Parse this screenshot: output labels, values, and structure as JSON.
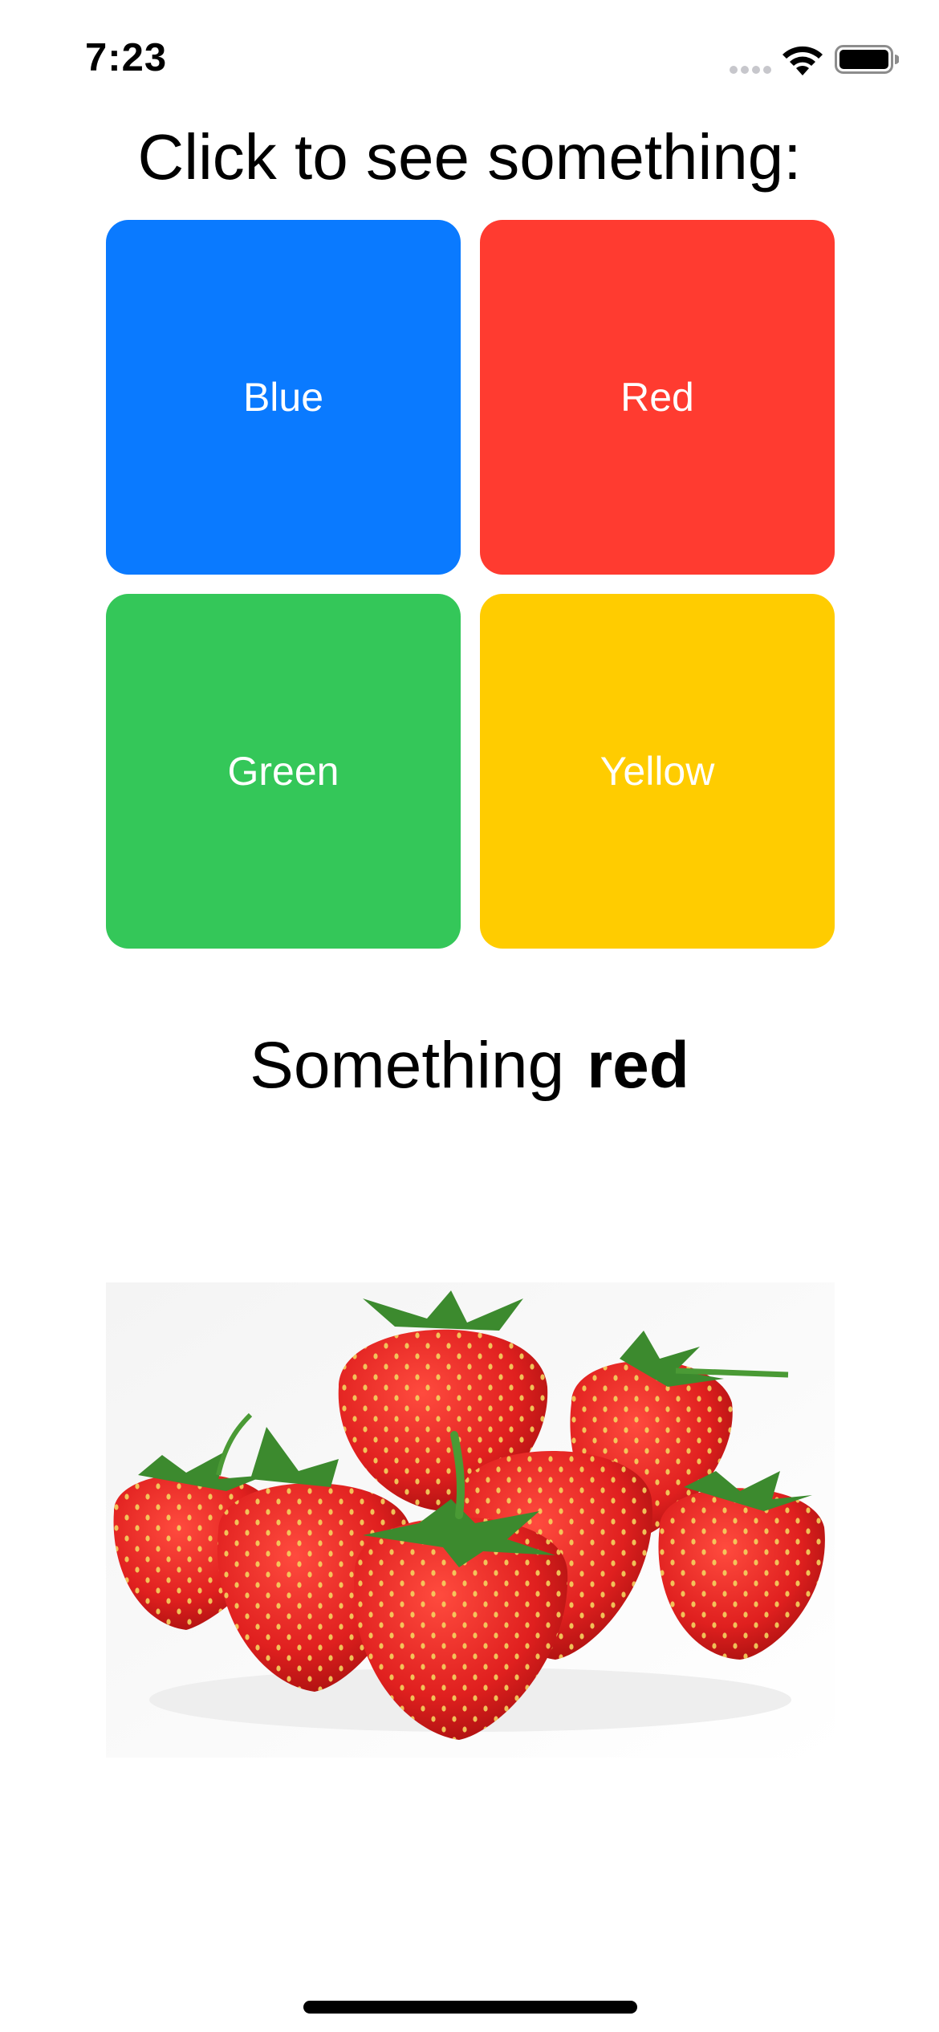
{
  "status_bar": {
    "time": "7:23"
  },
  "heading": {
    "title": "Click to see something:"
  },
  "buttons": {
    "blue": {
      "label": "Blue",
      "color": "#0a7aff"
    },
    "red": {
      "label": "Red",
      "color": "#ff3b30"
    },
    "green": {
      "label": "Green",
      "color": "#34c759"
    },
    "yellow": {
      "label": "Yellow",
      "color": "#ffcc00"
    }
  },
  "result": {
    "prefix": "Something",
    "color_word": "red"
  },
  "image": {
    "subject": "strawberries-photo"
  },
  "icons": {
    "signal": "cellular-signal-icon",
    "wifi": "wifi-icon",
    "battery": "battery-icon"
  }
}
